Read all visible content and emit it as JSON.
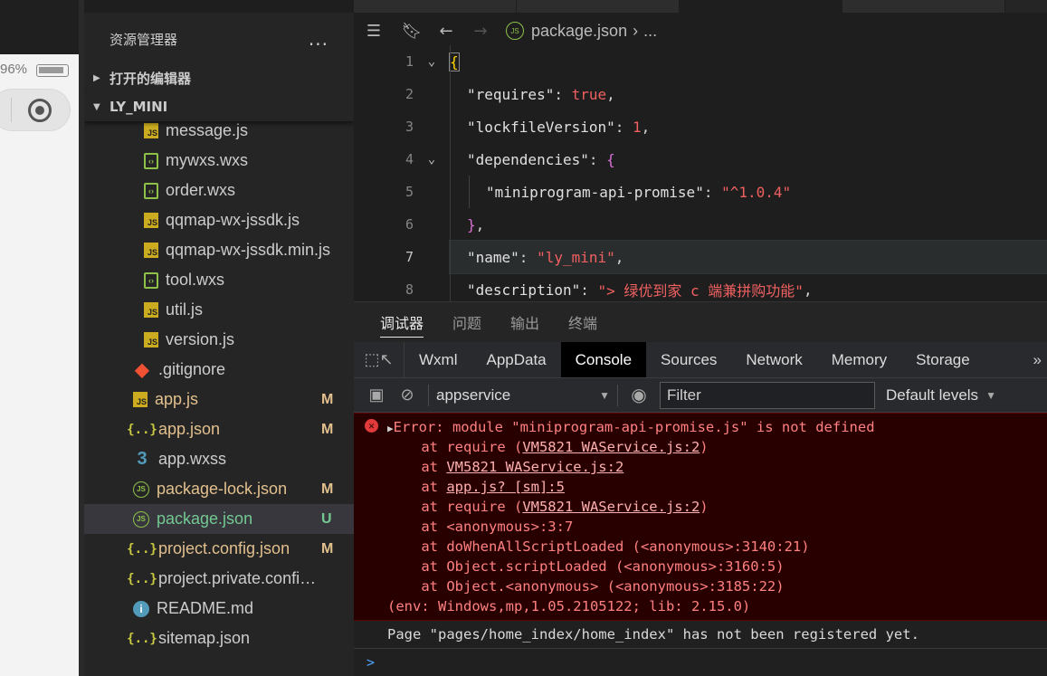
{
  "simulator": {
    "battery_percent": "96%"
  },
  "explorer": {
    "title": "资源管理器",
    "more": "...",
    "open_editors": "打开的编辑器",
    "project": "LY_MINI",
    "files": [
      {
        "name": "message.js",
        "icon": "js",
        "badge": "",
        "indent": 2
      },
      {
        "name": "mywxs.wxs",
        "icon": "wxs",
        "badge": "",
        "indent": 2
      },
      {
        "name": "order.wxs",
        "icon": "wxs",
        "badge": "",
        "indent": 2
      },
      {
        "name": "qqmap-wx-jssdk.js",
        "icon": "js",
        "badge": "",
        "indent": 2
      },
      {
        "name": "qqmap-wx-jssdk.min.js",
        "icon": "js",
        "badge": "",
        "indent": 2
      },
      {
        "name": "tool.wxs",
        "icon": "wxs",
        "badge": "",
        "indent": 2
      },
      {
        "name": "util.js",
        "icon": "js",
        "badge": "",
        "indent": 2
      },
      {
        "name": "version.js",
        "icon": "js",
        "badge": "",
        "indent": 2
      },
      {
        "name": ".gitignore",
        "icon": "git",
        "badge": "",
        "indent": 1
      },
      {
        "name": "app.js",
        "icon": "js",
        "badge": "M",
        "indent": 1
      },
      {
        "name": "app.json",
        "icon": "json",
        "badge": "M",
        "indent": 1
      },
      {
        "name": "app.wxss",
        "icon": "css",
        "badge": "",
        "indent": 1
      },
      {
        "name": "package-lock.json",
        "icon": "node",
        "badge": "M",
        "indent": 1
      },
      {
        "name": "package.json",
        "icon": "node",
        "badge": "U",
        "indent": 1,
        "selected": true
      },
      {
        "name": "project.config.json",
        "icon": "json",
        "badge": "M",
        "indent": 1
      },
      {
        "name": "project.private.config.js...",
        "icon": "json",
        "badge": "",
        "indent": 1
      },
      {
        "name": "README.md",
        "icon": "info",
        "badge": "",
        "indent": 1
      },
      {
        "name": "sitemap.json",
        "icon": "json",
        "badge": "",
        "indent": 1
      }
    ],
    "colors": {
      "modified": "#e2c08d",
      "untracked": "#73c991"
    }
  },
  "editor": {
    "breadcrumb_file": "package.json",
    "breadcrumb_more": "...",
    "lines": [
      {
        "n": "1",
        "fold": true,
        "html": "{",
        "current": false
      },
      {
        "n": "2",
        "fold": false,
        "current": false
      },
      {
        "n": "3",
        "fold": false,
        "current": false
      },
      {
        "n": "4",
        "fold": true,
        "current": false
      },
      {
        "n": "5",
        "fold": false,
        "current": false
      },
      {
        "n": "6",
        "fold": false,
        "current": false
      },
      {
        "n": "7",
        "fold": false,
        "current": true
      },
      {
        "n": "8",
        "fold": false,
        "current": false
      }
    ],
    "code": {
      "l1": "{",
      "l2_key": "\"requires\"",
      "l2_val": "true",
      "l3_key": "\"lockfileVersion\"",
      "l3_val": "1",
      "l4_key": "\"dependencies\"",
      "l5_key": "\"miniprogram-api-promise\"",
      "l5_val": "\"^1.0.4\"",
      "l6": "}",
      "l7_key": "\"name\"",
      "l7_val": "\"ly_mini\"",
      "l8_key": "\"description\"",
      "l8_val": "\"> 绿优到家 c 端兼拼购功能\""
    }
  },
  "panel": {
    "tabs": [
      "调试器",
      "问题",
      "输出",
      "终端"
    ],
    "active_tab": 0,
    "devtools_tabs": [
      "Wxml",
      "AppData",
      "Console",
      "Sources",
      "Network",
      "Memory",
      "Storage"
    ],
    "active_devtools_tab": "Console",
    "context": "appservice",
    "filter_placeholder": "Filter",
    "levels": "Default levels",
    "error": {
      "header": "Error: module \"miniprogram-api-promise.js\" is not defined",
      "stack": [
        {
          "pre": "    at require (",
          "link": "VM5821 WAService.js:2",
          "post": ")"
        },
        {
          "pre": "    at ",
          "link": "VM5821 WAService.js:2",
          "post": ""
        },
        {
          "pre": "    at ",
          "link": "app.js? [sm]:5",
          "post": ""
        },
        {
          "pre": "    at require (",
          "link": "VM5821 WAService.js:2",
          "post": ")"
        },
        {
          "pre": "    at <anonymous>:3:7",
          "link": "",
          "post": ""
        },
        {
          "pre": "    at doWhenAllScriptLoaded (<anonymous>:3140:21)",
          "link": "",
          "post": ""
        },
        {
          "pre": "    at Object.scriptLoaded (<anonymous>:3160:5)",
          "link": "",
          "post": ""
        },
        {
          "pre": "    at Object.<anonymous> (<anonymous>:3185:22)",
          "link": "",
          "post": ""
        }
      ],
      "env": "(env: Windows,mp,1.05.2105122; lib: 2.15.0)"
    },
    "message": "Page \"pages/home_index/home_index\" has not been registered yet.",
    "prompt": ">"
  }
}
